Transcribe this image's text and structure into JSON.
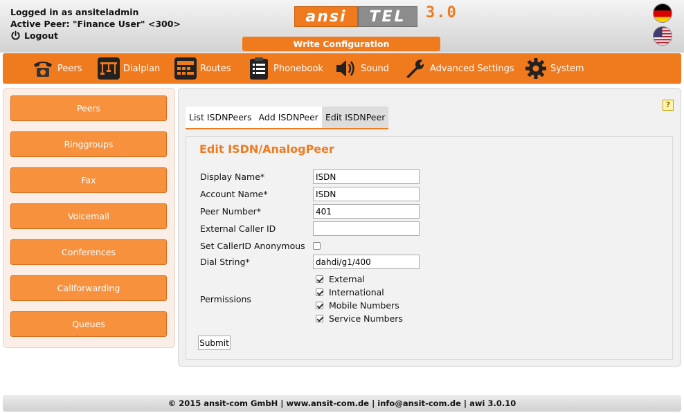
{
  "header": {
    "logged_in": "Logged in as ansiteladmin",
    "active_peer": "Active Peer: \"Finance User\" <300>",
    "logout_label": "Logout",
    "logo_part1": "ansi",
    "logo_part2": "TEL",
    "logo_version": "3.0",
    "write_config_label": "Write Configuration"
  },
  "nav": {
    "items": [
      {
        "label": "Peers",
        "icon": "phone-icon"
      },
      {
        "label": "Dialplan",
        "icon": "dialplan-icon"
      },
      {
        "label": "Routes",
        "icon": "routes-icon"
      },
      {
        "label": "Phonebook",
        "icon": "phonebook-icon"
      },
      {
        "label": "Sound",
        "icon": "speaker-icon"
      },
      {
        "label": "Advanced Settings",
        "icon": "wrench-icon"
      },
      {
        "label": "System",
        "icon": "gear-icon"
      }
    ]
  },
  "sidebar": {
    "items": [
      {
        "label": "Peers"
      },
      {
        "label": "Ringgroups"
      },
      {
        "label": "Fax"
      },
      {
        "label": "Voicemail"
      },
      {
        "label": "Conferences"
      },
      {
        "label": "Callforwarding"
      },
      {
        "label": "Queues"
      }
    ]
  },
  "tabs": [
    {
      "label": "List ISDNPeers",
      "active": false
    },
    {
      "label": "Add ISDNPeer",
      "active": false
    },
    {
      "label": "Edit ISDNPeer",
      "active": true
    }
  ],
  "help_label": "?",
  "form": {
    "title": "Edit ISDN/AnalogPeer",
    "display_name": {
      "label": "Display Name*",
      "value": "ISDN"
    },
    "account_name": {
      "label": "Account Name*",
      "value": "ISDN"
    },
    "peer_number": {
      "label": "Peer Number*",
      "value": "401"
    },
    "external_caller_id": {
      "label": "External Caller ID",
      "value": ""
    },
    "callerid_anonymous": {
      "label": "Set CallerID Anonymous",
      "checked": false
    },
    "dial_string": {
      "label": "Dial String*",
      "value": "dahdi/g1/400"
    },
    "permissions": {
      "label": "Permissions",
      "options": [
        {
          "label": "External",
          "checked": true
        },
        {
          "label": "International",
          "checked": true
        },
        {
          "label": "Mobile Numbers",
          "checked": true
        },
        {
          "label": "Service Numbers",
          "checked": true
        }
      ]
    },
    "submit_label": "Submit"
  },
  "footer": {
    "text": "© 2015 ansit-com GmbH | www.ansit-com.de | info@ansit-com.de | awi 3.0.10"
  },
  "colors": {
    "accent": "#f07a1e",
    "sidebar_bg": "#fbeee6",
    "panel_bg": "#f0f0f0"
  }
}
